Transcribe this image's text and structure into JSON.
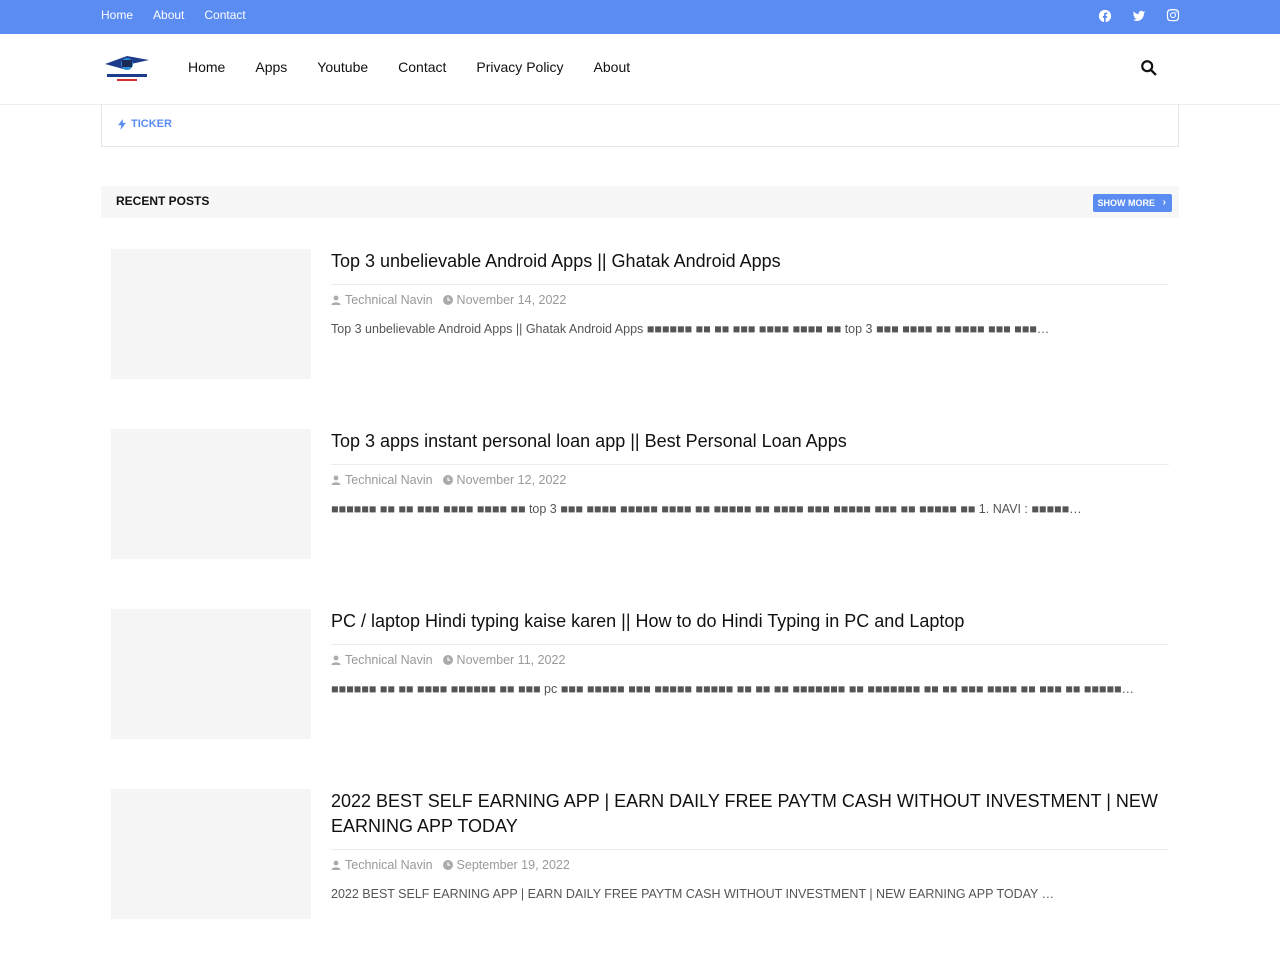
{
  "topbar": {
    "links": [
      "Home",
      "About",
      "Contact"
    ],
    "social": [
      "facebook-icon",
      "twitter-icon",
      "instagram-icon"
    ]
  },
  "header": {
    "logo_alt": "Technical Navin",
    "nav": [
      "Home",
      "Apps",
      "Youtube",
      "Contact",
      "Privacy Policy",
      "About"
    ]
  },
  "ticker": {
    "label": "TICKER"
  },
  "section": {
    "title": "RECENT POSTS",
    "more": "SHOW MORE"
  },
  "posts": [
    {
      "title": "Top 3 unbelievable Android Apps || Ghatak Android Apps",
      "author": "Technical Navin",
      "date": "November 14, 2022",
      "snippet": "Top 3 unbelievable Android Apps || Ghatak Android Apps  ■■■■■■ ■■ ■■ ■■■ ■■■■ ■■■■ ■■ top 3 ■■■ ■■■■ ■■ ■■■■ ■■■ ■■■…"
    },
    {
      "title": "Top 3 apps instant personal loan app || Best Personal Loan Apps",
      "author": "Technical Navin",
      "date": "November 12, 2022",
      "snippet": "■■■■■■ ■■ ■■ ■■■ ■■■■ ■■■■ ■■ top 3 ■■■ ■■■■ ■■■■■ ■■■■ ■■ ■■■■■ ■■ ■■■■ ■■■ ■■■■■ ■■■ ■■ ■■■■■ ■■   1. NAVI :  ■■■■■…"
    },
    {
      "title": "PC / laptop Hindi typing kaise karen || How to do Hindi Typing in PC and Laptop",
      "author": "Technical Navin",
      "date": "November 11, 2022",
      "snippet": "■■■■■■ ■■ ■■ ■■■■ ■■■■■■ ■■ ■■■ pc ■■■ ■■■■■ ■■■ ■■■■■ ■■■■■ ■■ ■■ ■■ ■■■■■■■ ■■ ■■■■■■■ ■■ ■■ ■■■ ■■■■ ■■ ■■■ ■■ ■■■■■…"
    },
    {
      "title": " 2022 BEST SELF EARNING APP | EARN DAILY FREE PAYTM CASH WITHOUT INVESTMENT | NEW EARNING APP TODAY",
      "author": "Technical Navin",
      "date": "September 19, 2022",
      "snippet": " 2022 BEST SELF EARNING APP | EARN DAILY FREE PAYTM CASH WITHOUT INVESTMENT | NEW EARNING APP TODAY                  …"
    }
  ]
}
